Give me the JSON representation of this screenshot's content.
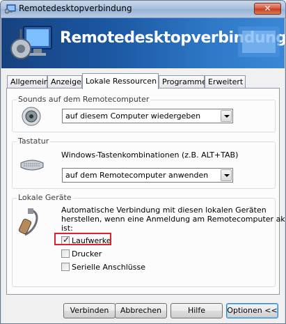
{
  "window": {
    "title": "Remotedesktopverbindung",
    "close_symbol": "✕",
    "banner_title": "Remotedesktopverbindung"
  },
  "tabs": [
    {
      "label": "Allgemein",
      "active": false
    },
    {
      "label": "Anzeige",
      "active": false
    },
    {
      "label": "Lokale Ressourcen",
      "active": true
    },
    {
      "label": "Programme",
      "active": false
    },
    {
      "label": "Erweitert",
      "active": false
    }
  ],
  "sounds": {
    "group_label": "Sounds auf dem Remotecomputer",
    "icon": "speaker-icon",
    "selected": "auf diesem Computer wiedergeben"
  },
  "keyboard": {
    "group_label": "Tastatur",
    "icon": "keyboard-icon",
    "description": "Windows-Tastenkombinationen (z.B. ALT+TAB)",
    "selected": "auf dem Remotecomputer anwenden"
  },
  "devices": {
    "group_label": "Lokale Geräte",
    "icon": "plug-icon",
    "description_lines": [
      "Automatische Verbindung mit diesen lokalen Geräten",
      "herstellen, wenn eine Anmeldung am Remotecomputer aktiv",
      "ist:"
    ],
    "options": [
      {
        "label": "Laufwerke",
        "checked": true
      },
      {
        "label": "Drucker",
        "checked": false
      },
      {
        "label": "Serielle Anschlüsse",
        "checked": false
      }
    ],
    "check_symbol": "✓"
  },
  "buttons": {
    "connect": "Verbinden",
    "cancel": "Abbrechen",
    "help": "Hilfe",
    "options": "Optionen <<"
  },
  "colors": {
    "banner_dark": "#16427e",
    "banner_light": "#3b86d6",
    "highlight": "#e0202a"
  }
}
